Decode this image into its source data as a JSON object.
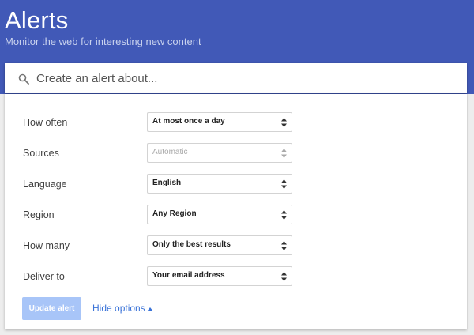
{
  "header": {
    "title": "Alerts",
    "subtitle": "Monitor the web for interesting new content"
  },
  "search": {
    "placeholder": "Create an alert about...",
    "icon": "search-icon"
  },
  "options": {
    "how_often": {
      "label": "How often",
      "value": "At most once a day"
    },
    "sources": {
      "label": "Sources",
      "value": "Automatic"
    },
    "language": {
      "label": "Language",
      "value": "English"
    },
    "region": {
      "label": "Region",
      "value": "Any Region"
    },
    "how_many": {
      "label": "How many",
      "value": "Only the best results"
    },
    "deliver_to": {
      "label": "Deliver to",
      "value": "Your email address"
    }
  },
  "actions": {
    "update_label": "Update alert",
    "hide_options_label": "Hide options"
  },
  "colors": {
    "header_bg": "#4159b7",
    "link": "#3a73d8",
    "button_disabled": "#a8c5f8"
  }
}
